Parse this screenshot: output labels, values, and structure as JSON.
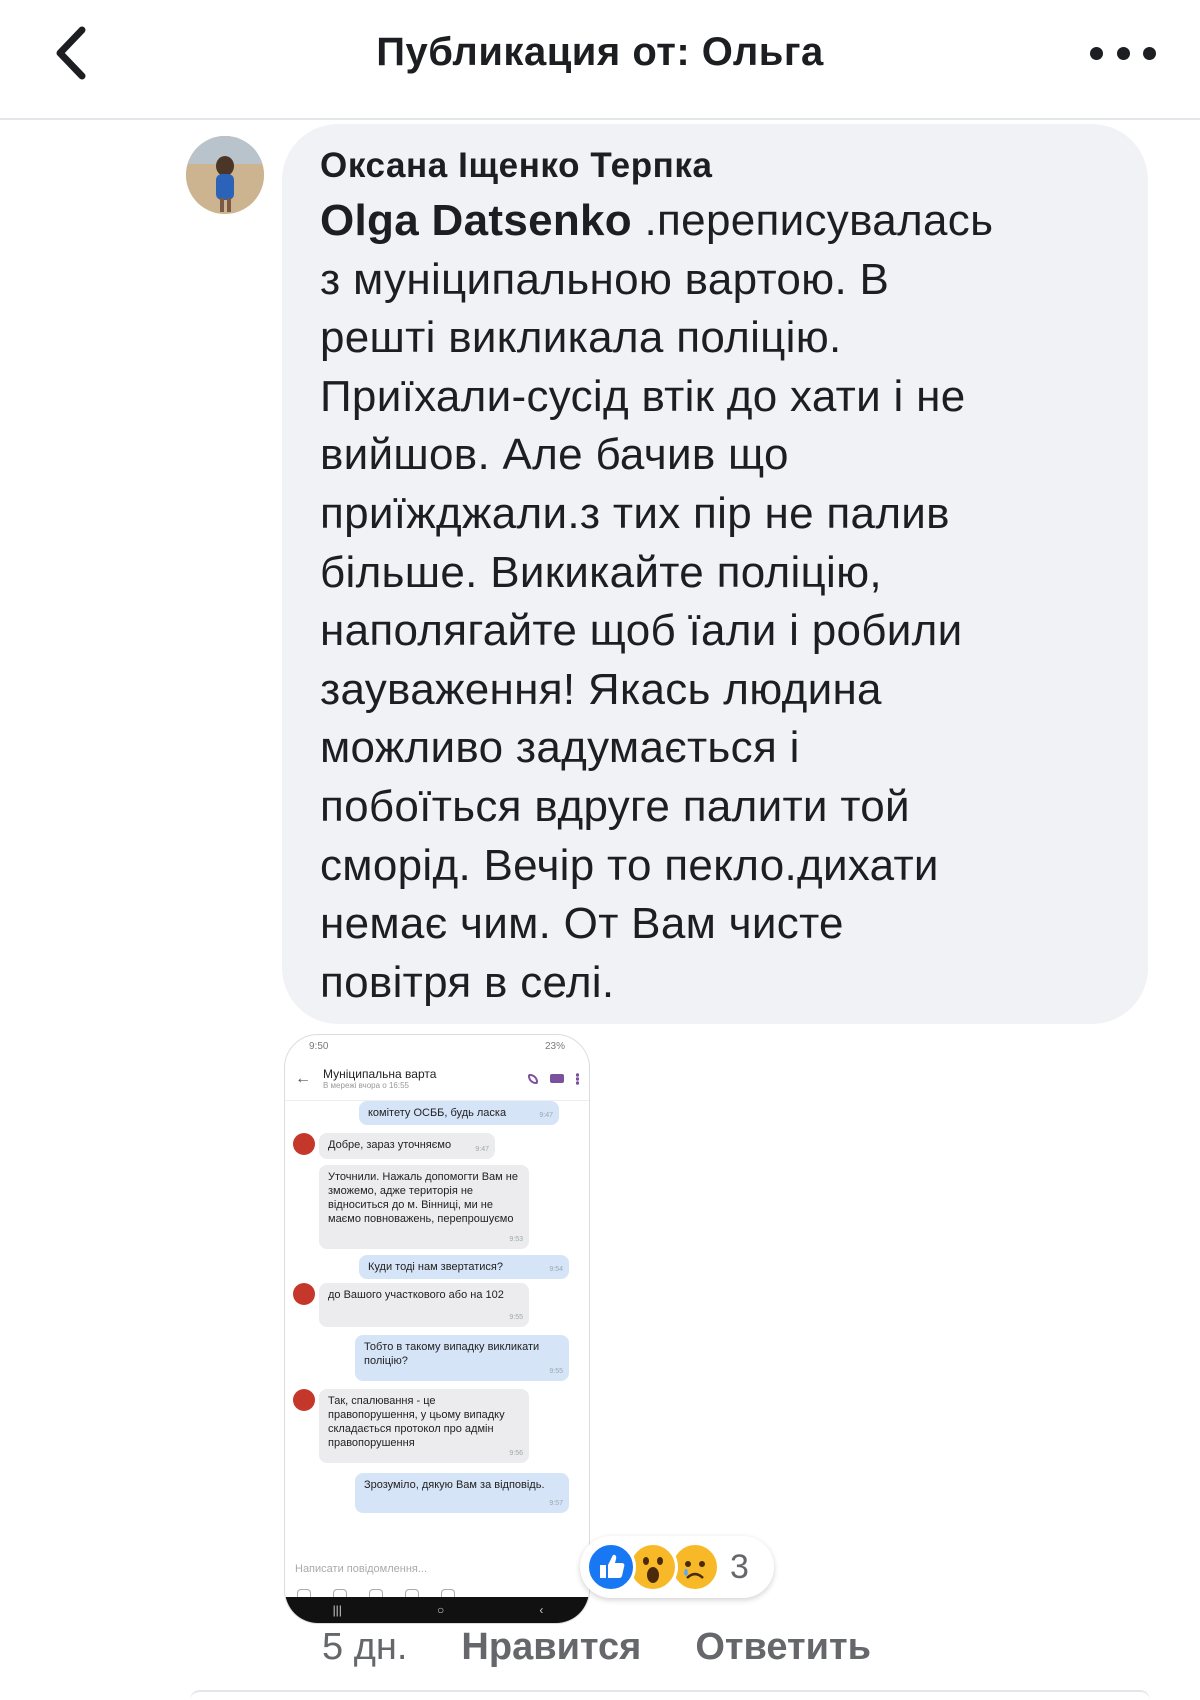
{
  "header": {
    "title": "Публикация от: Ольга",
    "back_icon": "chevron-left-icon",
    "more_icon": "more-horizontal-icon"
  },
  "comment": {
    "author": "Оксана Іщенко Терпка",
    "mention": "Olga  Datsenko",
    "lines": [
      " .переписувалась",
      "з муніципальною вартою.  В",
      "решті викликала поліцію.",
      "Приїхали-сусід втік до хати і не",
      "вийшов. Але бачив що",
      "приїжджали.з тих пір не палив",
      "більше. Викикайте поліцію,",
      "наполягайте щоб їали і робили",
      "зауваження! Якась людина",
      "можливо задумається і",
      "побоїться вдруге палити той",
      "сморід. Вечір то пекло.дихати",
      "немає чим. От Вам чисте",
      "повітря в селі."
    ]
  },
  "attachment": {
    "status_left": "9:50",
    "status_right": "23%",
    "chat_title": "Муніципальна варта",
    "chat_subtitle": "В мережі вчора о 16:55",
    "messages": [
      {
        "dir": "out",
        "text": "комітету ОСББ, будь ласка",
        "time": "9:47"
      },
      {
        "dir": "in",
        "text": "Добре, зараз уточняємо",
        "time": "9:47"
      },
      {
        "dir": "in",
        "text": "Уточнили. Нажаль допомогти Вам не зможемо, адже територія не відноситься до м. Вінниці, ми не маємо повноважень, перепрошуємо",
        "time": "9:53"
      },
      {
        "dir": "out",
        "text": "Куди тоді нам звертатися?",
        "time": "9:54"
      },
      {
        "dir": "in",
        "text": "до Вашого участкового або на 102",
        "time": "9:55"
      },
      {
        "dir": "out",
        "text": "Тобто в такому випадку викликати поліцію?",
        "time": "9:55"
      },
      {
        "dir": "in",
        "text": "Так, спалювання - це правопорушення, у цьому випадку складається протокол про адмін правопорушення",
        "time": "9:56"
      },
      {
        "dir": "out",
        "text": "Зрозуміло, дякую Вам за відповідь.",
        "time": "9:57"
      }
    ],
    "input_placeholder": "Написати повідомлення..."
  },
  "reactions": {
    "icons": [
      "like-reaction-icon",
      "wow-reaction-icon",
      "sad-reaction-icon"
    ],
    "count": "3"
  },
  "footer": {
    "time": "5 дн.",
    "like_label": "Нравится",
    "reply_label": "Ответить"
  }
}
